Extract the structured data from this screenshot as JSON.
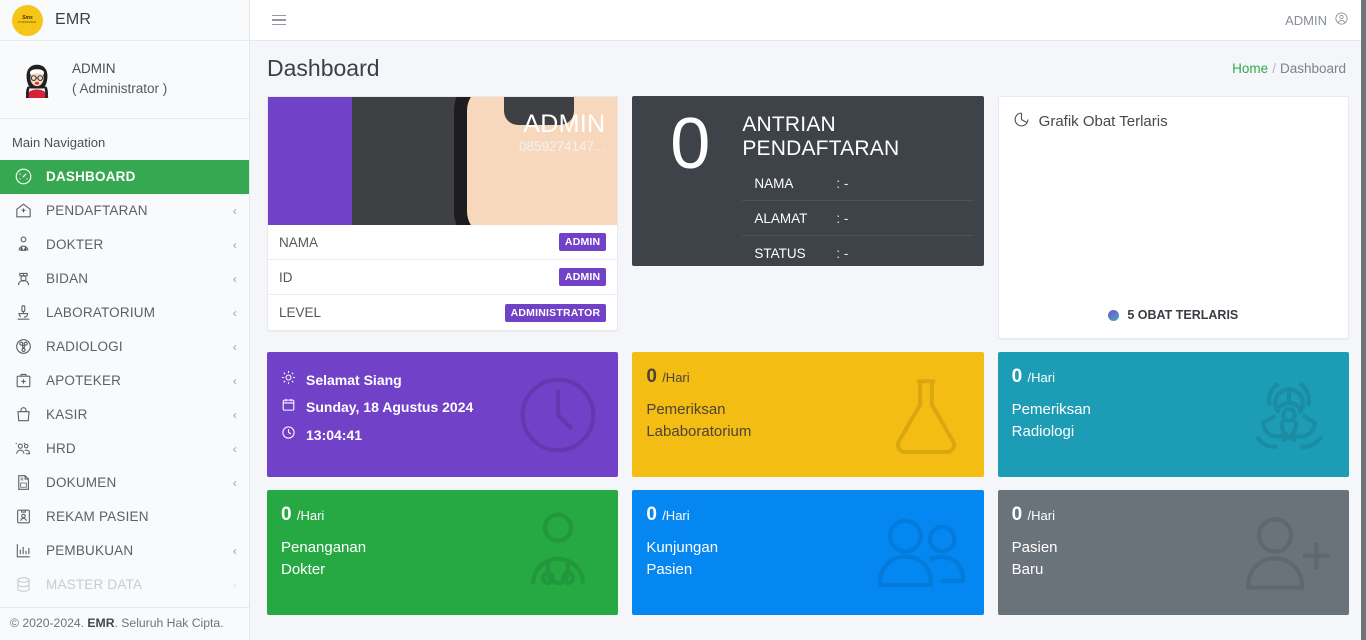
{
  "brand": {
    "name": "EMR",
    "logo_line1": "Sms",
    "logo_line2": "PUSKESMAS",
    "logo_color": "#f5c518"
  },
  "sidebar": {
    "user": {
      "name": "ADMIN",
      "role": "( Administrator )"
    },
    "nav_header": "Main Navigation",
    "items": [
      {
        "label": "DASHBOARD",
        "icon": "dashboard-icon",
        "active": true,
        "caret": ""
      },
      {
        "label": "PENDAFTARAN",
        "icon": "hospital-icon",
        "active": false,
        "caret": "‹"
      },
      {
        "label": "DOKTER",
        "icon": "doctor-icon",
        "active": false,
        "caret": "‹"
      },
      {
        "label": "BIDAN",
        "icon": "nurse-icon",
        "active": false,
        "caret": "‹"
      },
      {
        "label": "LABORATORIUM",
        "icon": "microscope-icon",
        "active": false,
        "caret": "‹"
      },
      {
        "label": "RADIOLOGI",
        "icon": "radiology-icon",
        "active": false,
        "caret": "‹"
      },
      {
        "label": "APOTEKER",
        "icon": "medkit-icon",
        "active": false,
        "caret": "‹"
      },
      {
        "label": "KASIR",
        "icon": "bag-icon",
        "active": false,
        "caret": "‹"
      },
      {
        "label": "HRD",
        "icon": "people-icon",
        "active": false,
        "caret": "‹"
      },
      {
        "label": "DOKUMEN",
        "icon": "document-icon",
        "active": false,
        "caret": "‹"
      },
      {
        "label": "REKAM PASIEN",
        "icon": "id-card-icon",
        "active": false,
        "caret": ""
      },
      {
        "label": "PEMBUKUAN",
        "icon": "bar-chart-icon",
        "active": false,
        "caret": "‹"
      },
      {
        "label": "MASTER DATA",
        "icon": "database-icon",
        "active": false,
        "caret": "‹"
      }
    ],
    "footer": {
      "prefix": "© 2020-2024. ",
      "brand": "EMR",
      "suffix": ". Seluruh Hak Cipta."
    }
  },
  "topbar": {
    "menu_icon": "hamburger-icon",
    "user_label": "ADMIN",
    "user_icon": "user-circle-icon"
  },
  "page": {
    "title": "Dashboard",
    "breadcrumb": {
      "home": "Home",
      "separator": "/",
      "current": "Dashboard"
    }
  },
  "profile_card": {
    "hero_name": "ADMIN",
    "hero_phone": "0859274147...",
    "avatar": "admin-avatar",
    "rows": [
      {
        "label": "NAMA",
        "badge": "ADMIN"
      },
      {
        "label": "ID",
        "badge": "ADMIN"
      },
      {
        "label": "LEVEL",
        "badge": "ADMINISTRATOR"
      }
    ]
  },
  "antrian_card": {
    "count": "0",
    "title_line1": "ANTRIAN",
    "title_line2": "PENDAFTARAN",
    "rows": [
      {
        "label": "NAMA",
        "value": ": -"
      },
      {
        "label": "ALAMAT",
        "value": ": -"
      },
      {
        "label": "STATUS",
        "value": ": -"
      }
    ]
  },
  "grafik_card": {
    "title": "Grafik Obat Terlaris",
    "title_icon": "pie-chart-icon",
    "legend": "5 OBAT TERLARIS"
  },
  "greeting_tile": {
    "greeting": "Selamat Siang",
    "date": "Sunday, 18 Agustus 2024",
    "time": "13:04:41",
    "greeting_icon": "sun-icon",
    "date_icon": "calendar-icon",
    "time_icon": "clock-icon",
    "bg_icon": "clock-big-icon"
  },
  "tiles": [
    {
      "count": "0",
      "unit": "/Hari",
      "line1": "Pemeriksan",
      "line2": "Lababoratorium",
      "color": "yellow",
      "icon": "flask-icon"
    },
    {
      "count": "0",
      "unit": "/Hari",
      "line1": "Pemeriksan",
      "line2": "Radiologi",
      "color": "teal",
      "icon": "biohazard-icon"
    },
    {
      "count": "0",
      "unit": "/Hari",
      "line1": "Penanganan",
      "line2": "Dokter",
      "color": "green",
      "icon": "doctor-big-icon"
    },
    {
      "count": "0",
      "unit": "/Hari",
      "line1": "Kunjungan",
      "line2": "Pasien",
      "color": "blue",
      "icon": "users-icon"
    },
    {
      "count": "0",
      "unit": "/Hari",
      "line1": "Pasien",
      "line2": "Baru",
      "color": "gray",
      "icon": "user-plus-icon"
    }
  ],
  "chart_data": {
    "type": "pie",
    "title": "Grafik Obat Terlaris",
    "legend": [
      "5 OBAT TERLARIS"
    ],
    "legend_position": "bottom",
    "categories": [],
    "values": []
  },
  "colors": {
    "accent_green": "#36a852",
    "purple": "#7141c8",
    "yellow": "#f4bd13",
    "teal": "#1d9cb5",
    "green": "#26a843",
    "blue": "#0487f0",
    "gray": "#6a727a",
    "dark": "#3d4349"
  }
}
